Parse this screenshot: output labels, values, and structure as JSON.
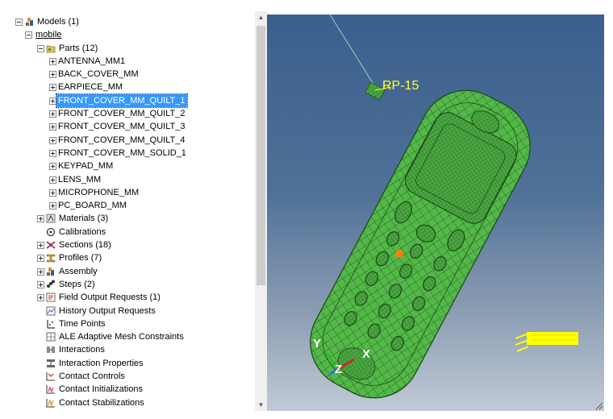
{
  "tree": {
    "models_label": "Models (1)",
    "model_name": "mobile",
    "parts_label": "Parts (12)",
    "parts": [
      "ANTENNA_MM1",
      "BACK_COVER_MM",
      "EARPIECE_MM",
      "FRONT_COVER_MM_QUILT_1",
      "FRONT_COVER_MM_QUILT_2",
      "FRONT_COVER_MM_QUILT_3",
      "FRONT_COVER_MM_QUILT_4",
      "FRONT_COVER_MM_SOLID_1",
      "KEYPAD_MM",
      "LENS_MM",
      "MICROPHONE_MM",
      "PC_BOARD_MM"
    ],
    "selected_part": "FRONT_COVER_MM_QUILT_1",
    "items": {
      "materials": "Materials (3)",
      "calibrations": "Calibrations",
      "sections": "Sections (18)",
      "profiles": "Profiles (7)",
      "assembly": "Assembly",
      "steps": "Steps (2)",
      "field_output": "Field Output Requests (1)",
      "history_output": "History Output Requests",
      "time_points": "Time Points",
      "ale": "ALE Adaptive Mesh Constraints",
      "interactions": "Interactions",
      "interaction_properties": "Interaction Properties",
      "contact_controls": "Contact Controls",
      "contact_initializations": "Contact Initializations",
      "contact_stabilizations": "Contact Stabilizations"
    }
  },
  "viewport": {
    "reference_point_label": "RP-15",
    "triad": {
      "x": "X",
      "y": "Y",
      "z": "Z"
    },
    "colors": {
      "mesh_fill": "#52b848",
      "mesh_lines": "#1f4d1a",
      "highlight": "#ffff00",
      "reference_point": "#ff8000"
    }
  },
  "icons": {
    "models": "models-icon",
    "parts": "parts-folder-icon",
    "materials": "materials-icon",
    "calibrations": "calibrations-icon",
    "sections": "sections-icon",
    "profiles": "profiles-icon",
    "assembly": "assembly-icon",
    "steps": "steps-icon",
    "field_output": "field-output-icon",
    "history_output": "history-output-icon",
    "time_points": "time-points-icon",
    "ale": "ale-icon",
    "interactions": "interactions-icon",
    "interaction_properties": "interaction-properties-icon",
    "contact_controls": "contact-controls-icon",
    "contact_initializations": "contact-initializations-icon",
    "contact_stabilizations": "contact-stabilizations-icon"
  }
}
